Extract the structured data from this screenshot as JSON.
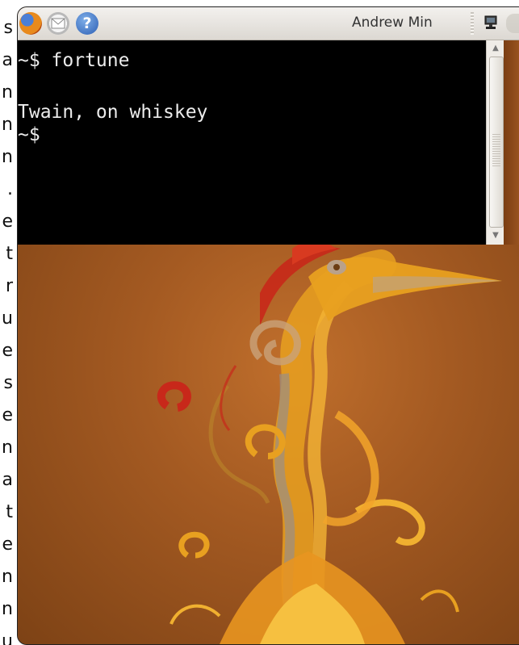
{
  "article": {
    "line_endings": [
      "s",
      "a",
      "n",
      "n",
      "n",
      ".",
      "e",
      "t",
      "r",
      "u",
      "e",
      "s",
      "e",
      "n",
      "a",
      "t",
      "e",
      "n",
      "n",
      "u"
    ]
  },
  "panel": {
    "icons": [
      "firefox-icon",
      "mail-icon",
      "help-icon"
    ],
    "help_glyph": "?",
    "user_name": "Andrew Min",
    "right_icons": [
      "network-icon"
    ]
  },
  "terminal": {
    "lines": [
      "~$ fortune",
      "",
      "Twain, on whiskey",
      "~$"
    ]
  },
  "colors": {
    "terminal_bg": "#000000",
    "terminal_fg": "#ececec",
    "panel_bg": "#e6e3de",
    "wallpaper_base": "#a45a22",
    "wallpaper_accent": "#e8a020",
    "wallpaper_red": "#c8281a"
  }
}
